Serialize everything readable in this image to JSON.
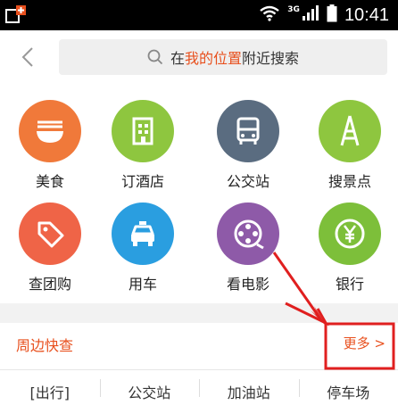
{
  "status_bar": {
    "time": "10:41",
    "network": "3G",
    "icons": [
      "app-notification-icon",
      "wifi-icon",
      "signal-icon",
      "battery-icon"
    ]
  },
  "search": {
    "placeholder_prefix": "在",
    "placeholder_highlight": "我的位置",
    "placeholder_suffix": "附近搜索",
    "highlight_color": "#e8501e"
  },
  "categories": [
    {
      "label": "美食",
      "icon": "noodle-bowl-icon",
      "color": "#f0793a"
    },
    {
      "label": "订酒店",
      "icon": "hotel-building-icon",
      "color": "#8ec63f"
    },
    {
      "label": "公交站",
      "icon": "bus-icon",
      "color": "#5a6c80"
    },
    {
      "label": "搜景点",
      "icon": "tower-icon",
      "color": "#8ec63f"
    },
    {
      "label": "查团购",
      "icon": "tag-icon",
      "color": "#ef6447"
    },
    {
      "label": "用车",
      "icon": "taxi-icon",
      "color": "#2a9ee0"
    },
    {
      "label": "看电影",
      "icon": "film-reel-icon",
      "color": "#8e5aa8"
    },
    {
      "label": "银行",
      "icon": "yen-coin-icon",
      "color": "#7dbf3a"
    }
  ],
  "quick_search": {
    "title": "周边快查",
    "more_label": "更多 >"
  },
  "quick_categories": [
    "[出行]",
    "公交站",
    "加油站",
    "停车场"
  ],
  "annotation": {
    "color": "#e01f1f"
  }
}
